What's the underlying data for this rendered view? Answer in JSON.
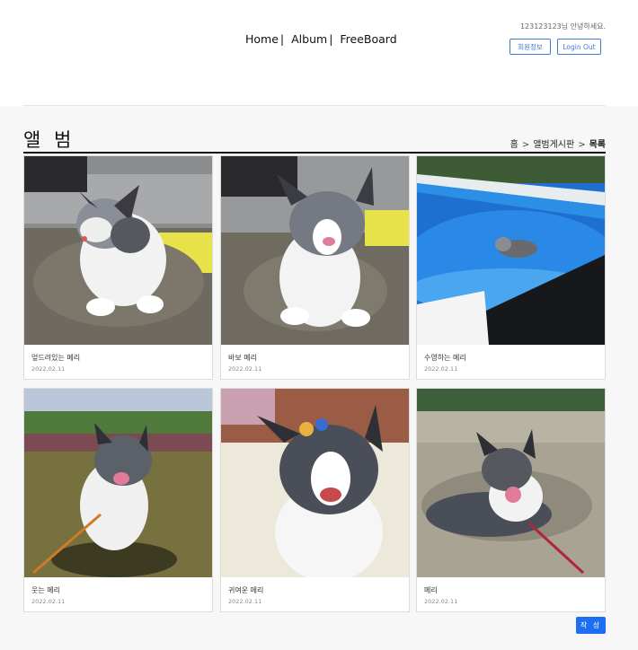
{
  "header": {
    "nav": [
      {
        "label": "Home"
      },
      {
        "label": "Album"
      },
      {
        "label": "FreeBoard"
      }
    ],
    "nav_separator": "|",
    "greeting": "123123123님 안녕하세요.",
    "profile_button": "회원정보",
    "logout_button": "Login Out"
  },
  "page": {
    "title": "앨 범",
    "breadcrumb": [
      "홈",
      "앨범게시판",
      "목록"
    ],
    "breadcrumb_separator": ">"
  },
  "album": {
    "items": [
      {
        "caption": "엎드려있는 메리",
        "date": "2022.02.11"
      },
      {
        "caption": "바보 메리",
        "date": "2022.02.11"
      },
      {
        "caption": "수영하는 메리",
        "date": "2022.02.11"
      },
      {
        "caption": "웃는 메리",
        "date": "2022.02.11"
      },
      {
        "caption": "귀여운 메리",
        "date": "2022.02.11"
      },
      {
        "caption": "메리",
        "date": "2022.02.11"
      }
    ]
  },
  "actions": {
    "write_button": "작 성"
  },
  "colors": {
    "accent": "#1d6ff2",
    "outline_button": "#3a7bd5",
    "content_background": "#f7f7f8"
  }
}
